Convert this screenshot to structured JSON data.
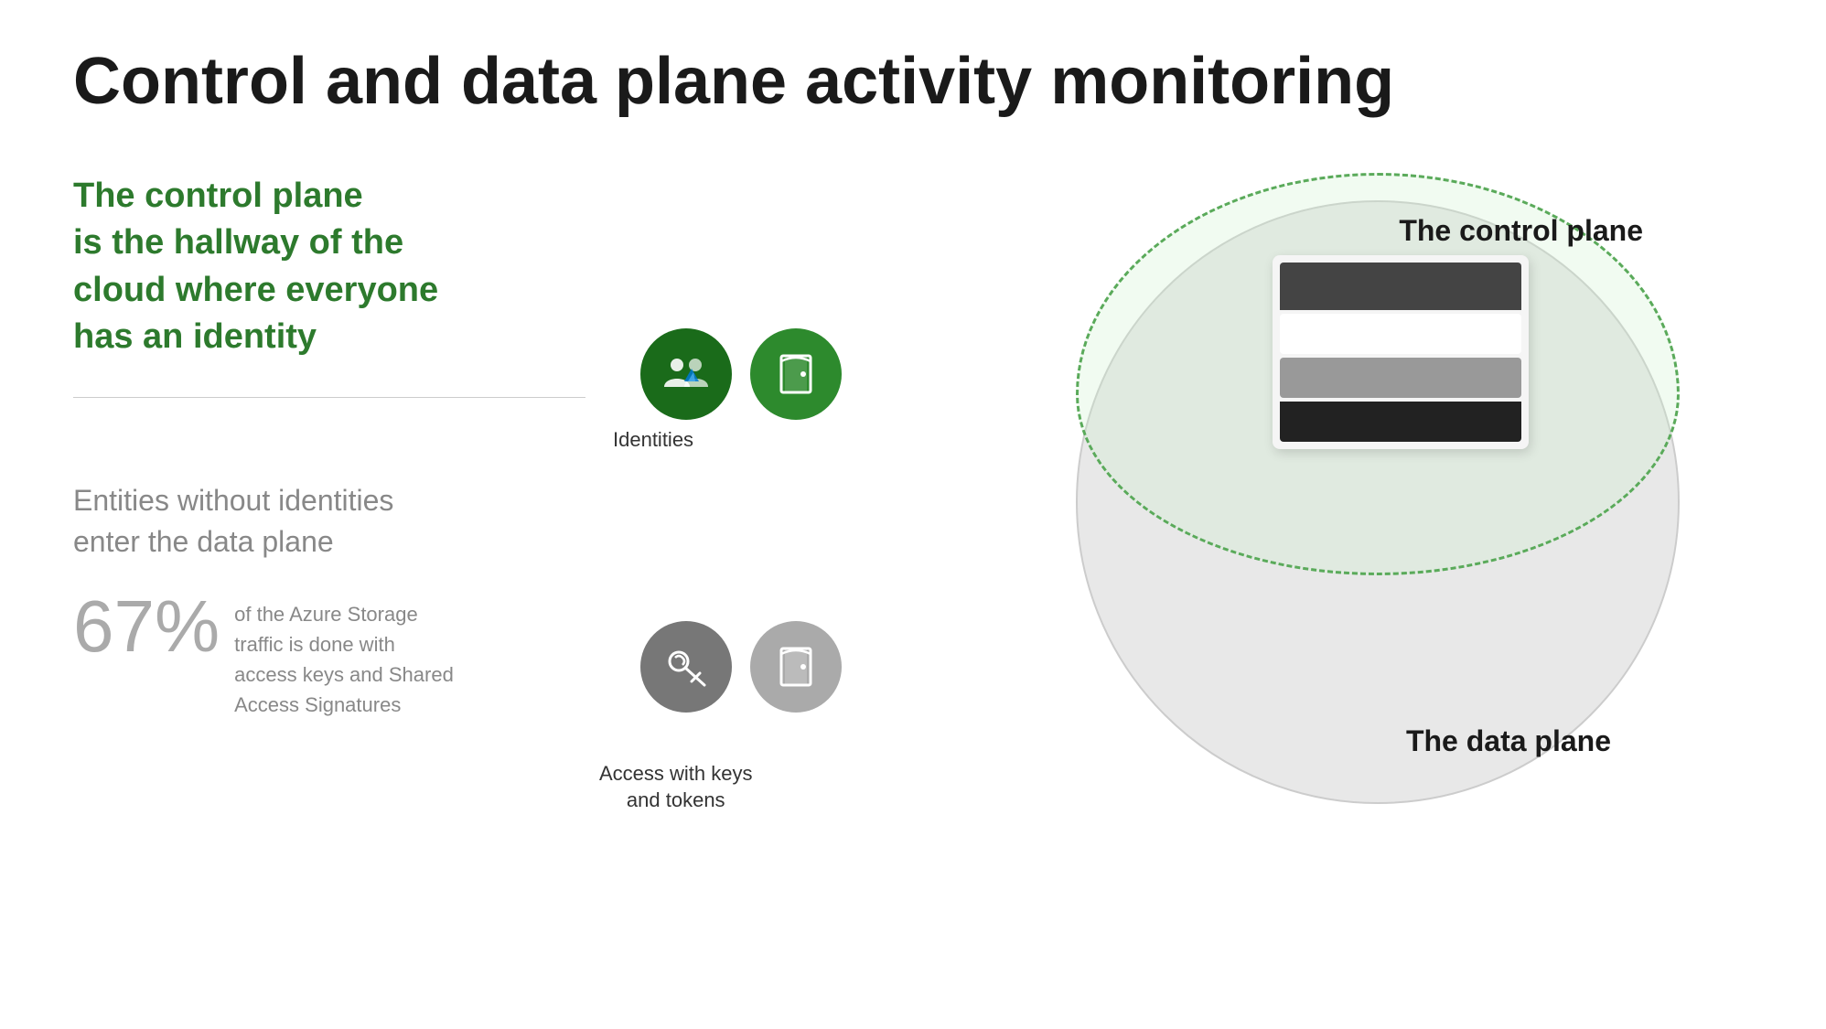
{
  "page": {
    "title": "Control and data plane activity monitoring"
  },
  "left": {
    "green_heading_line1": "The control plane",
    "green_heading_line2": "is the hallway of the",
    "green_heading_line3": "cloud where everyone",
    "green_heading_line4": "has an identity",
    "gray_title_line1": "Entities without identities",
    "gray_title_line2": "enter the data plane",
    "stat_number": "67%",
    "stat_description": "of the Azure Storage traffic is done with access keys and Shared Access Signatures"
  },
  "diagram": {
    "control_plane_label": "The control plane",
    "data_plane_label": "The data plane",
    "identities_label": "Identities",
    "keys_label": "Access with keys\nand tokens"
  }
}
